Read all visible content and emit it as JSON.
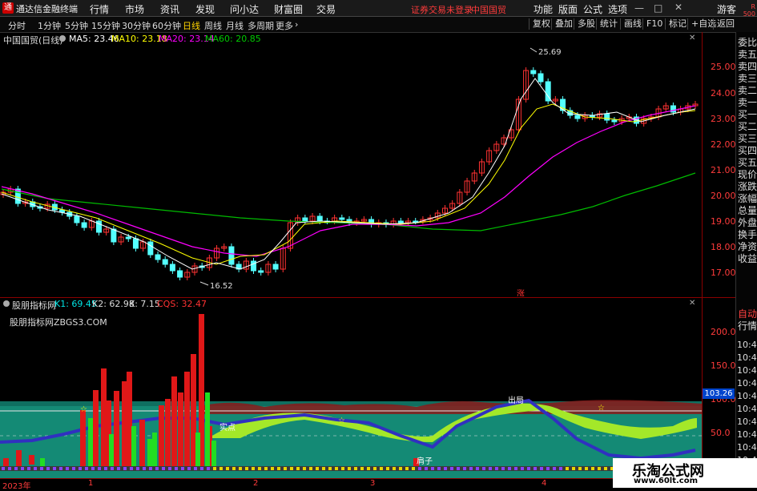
{
  "titlebar": {
    "app_title": "通达信金融终端",
    "menus": [
      "行情",
      "市场",
      "资讯",
      "发现",
      "问小达",
      "财富圈",
      "交易"
    ],
    "warning": "证券交易未登录",
    "stock": "中国国贸",
    "right_menus": [
      "功能",
      "版面",
      "公式",
      "选项"
    ],
    "guest": "游客"
  },
  "toolbar": {
    "periods": [
      "分时",
      "1分钟",
      "5分钟",
      "15分钟",
      "30分钟",
      "60分钟",
      "日线",
      "周线",
      "月线",
      "多周期",
      "更多"
    ],
    "active_period": "日线",
    "right_buttons": [
      "复权",
      "叠加",
      "多股",
      "统计",
      "画线",
      "F10",
      "标记",
      "+自选",
      "返回"
    ]
  },
  "main_chart": {
    "stock_label": "中国国贸(日线)",
    "ma5_label": "MA5: 23.46",
    "ma10_label": "MA10: 23.18",
    "ma20_label": "MA20: 23.14",
    "ma60_label": "MA60: 20.85",
    "high_label": "25.69",
    "low_label": "16.52",
    "zhang_label": "涨",
    "y_ticks": [
      "25.00",
      "24.00",
      "23.00",
      "22.00",
      "21.00",
      "20.00",
      "19.00",
      "18.00",
      "17.00"
    ]
  },
  "sub_chart": {
    "name": "股朋指标网",
    "k1": "K1: 69.45",
    "k2": "K2: 62.98",
    "k": "K: 7.15",
    "cqs": "CQS: 32.47",
    "site": "股朋指标网ZBGS3.COM",
    "buy_label": "实点",
    "sell_label": "出局",
    "ren_label": "肩子",
    "y_ticks": [
      "200.0",
      "150.0",
      "100.0",
      "50.0"
    ],
    "current_value": "103.26"
  },
  "right_column": {
    "r_tag": "R",
    "r_num": "500",
    "items": [
      "委比",
      "卖五",
      "卖四",
      "卖三",
      "卖二",
      "卖一",
      "买一",
      "买二",
      "买三",
      "买四",
      "买五",
      "现价",
      "涨跌",
      "涨幅",
      "总量",
      "外盘",
      "换手",
      "净资",
      "收益"
    ],
    "lower_items": [
      "自动",
      "行情"
    ],
    "times": [
      "10:44",
      "10:45",
      "10:45",
      "10:45",
      "10:45",
      "10:45",
      "10:45",
      "10:45",
      "10:45",
      "10:45"
    ]
  },
  "dates": [
    "2023年",
    "1",
    "2",
    "3",
    "4"
  ],
  "watermark": {
    "title": "乐淘公式网",
    "url": "www.60lt.com"
  },
  "colors": {
    "up": "#ff3232",
    "down": "#00ffff",
    "ma5": "#ffffff",
    "ma10": "#ffff00",
    "ma20": "#ff00ff",
    "ma60": "#00cc00",
    "axis": "#8b0000"
  }
}
